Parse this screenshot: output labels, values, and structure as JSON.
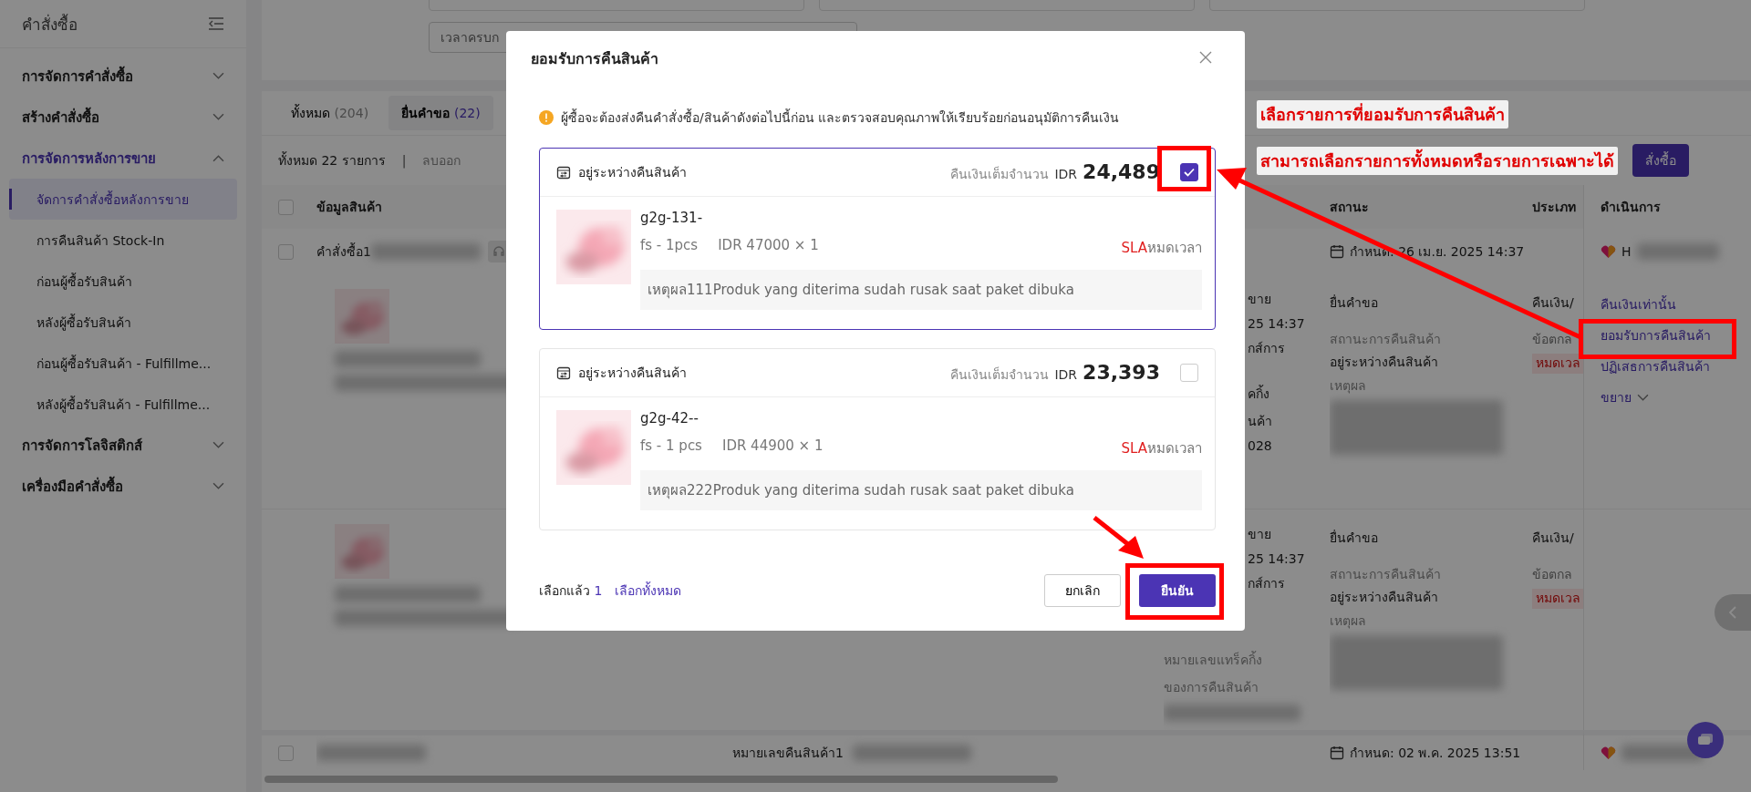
{
  "sidebar": {
    "title": "คำสั่งซื้อ",
    "groups": [
      {
        "label": "การจัดการคำสั่งซื้อ",
        "expanded": false
      },
      {
        "label": "สร้างคำสั่งซื้อ",
        "expanded": false
      },
      {
        "label": "การจัดการหลังการขาย",
        "expanded": true,
        "items": [
          {
            "label": "จัดการคำสั่งซื้อหลังการขาย",
            "selected": true
          },
          {
            "label": "การคืนสินค้า Stock-In",
            "selected": false
          },
          {
            "label": "ก่อนผู้ซื้อรับสินค้า",
            "selected": false
          },
          {
            "label": "หลังผู้ซื้อรับสินค้า",
            "selected": false
          },
          {
            "label": "ก่อนผู้ซื้อรับสินค้า - Fulfillme...",
            "selected": false
          },
          {
            "label": "หลังผู้ซื้อรับสินค้า - Fulfillme...",
            "selected": false
          }
        ]
      },
      {
        "label": "การจัดการโลจิสติกส์",
        "expanded": false
      },
      {
        "label": "เครื่องมือคำสั่งซื้อ",
        "expanded": false
      }
    ]
  },
  "filters": {
    "deadline_field": "เวลาครบก"
  },
  "tabs": [
    {
      "label": "ทั้งหมด",
      "count": "(204)",
      "selected": false
    },
    {
      "label": "ยื่นคำขอ",
      "count": "(22)",
      "selected": true
    }
  ],
  "toolbar": {
    "total": "ทั้งหมด 22 รายการ",
    "separator": "|",
    "remove": "ลบออก",
    "action_button": "สั่งซื้อ"
  },
  "table": {
    "columns": [
      "ข้อมูลสินค้า",
      "สถานะ",
      "ประเภท",
      "ดำเนินการ"
    ],
    "all_checked": false,
    "order_row": {
      "checked": false,
      "order": "คำสั่งซื้อ1",
      "deadline": "กำหนด: 26 เม.ย. 2025 14:37",
      "shop": "H"
    },
    "groups": [
      {
        "tail_blocks": [
          [
            "ขาย",
            "25 14:37",
            "กส์การ"
          ],
          [
            "คกิ้ง",
            "นค้า",
            "028"
          ]
        ],
        "status": {
          "title": "ยื่นคำขอ",
          "label": "สถานะการคืนสินค้า",
          "value": "อยู่ระหว่างคืนสินค้า",
          "reason": "เหตุผล"
        },
        "type": {
          "title": "คืนเงิน/",
          "subtitle": "ข้อตกล",
          "tag": "หมดเวล"
        },
        "actions": [
          {
            "label": "คืนเงินเท่านั้น"
          },
          {
            "label": "ยอมรับการคืนสินค้า"
          },
          {
            "label": "ปฏิเสธการคืนสินค้า"
          },
          {
            "label": "ขยาย",
            "kind": "expand"
          }
        ]
      },
      {
        "tail_blocks": [
          [
            "ขาย",
            "25 14:37",
            "กส์การ"
          ]
        ],
        "middle": [
          "หมายเลขแทร็คกิ้ง",
          "ของการคืนสินค้า"
        ],
        "status": {
          "title": "ยื่นคำขอ",
          "label": "สถานะการคืนสินค้า",
          "value": "อยู่ระหว่างคืนสินค้า",
          "reason": "เหตุผล"
        },
        "type": {
          "title": "คืนเงิน/",
          "subtitle": "ข้อตกล",
          "tag": "หมดเวล"
        }
      }
    ],
    "bottom_row": {
      "checked": false,
      "return_no": "หมายเลขคืนสินค้า1",
      "deadline": "กำหนด:  02 พ.ค. 2025 13:51"
    }
  },
  "modal": {
    "title": "ยอมรับการคืนสินค้า",
    "notice": "ผู้ซื้อจะต้องส่งคืนคำสั่งซื้อ/สินค้าดังต่อไปนี้ก่อน และตรวจสอบคุณภาพให้เรียบร้อยก่อนอนุมัติการคืนเงิน",
    "items": [
      {
        "status": "อยู่ระหว่างคืนสินค้า",
        "refund_label": "คืนเงินเต็มจำนวน",
        "currency": "IDR",
        "amount": "24,489",
        "selected": true,
        "name": "g2g-131-",
        "variant": "fs - 1pcs",
        "price": "IDR 47000 × 1",
        "sla": "SLA",
        "sla_state": "หมดเวลา",
        "reason": "เหตุผล111Produk yang diterima sudah rusak saat paket dibuka"
      },
      {
        "status": "อยู่ระหว่างคืนสินค้า",
        "refund_label": "คืนเงินเต็มจำนวน",
        "currency": "IDR",
        "amount": "23,393",
        "selected": false,
        "name": "g2g-42--",
        "variant": "fs - 1 pcs",
        "price": "IDR 44900 × 1",
        "sla": "SLA",
        "sla_state": "หมดเวลา",
        "reason": "เหตุผล222Produk yang diterima sudah rusak saat paket dibuka"
      }
    ],
    "selected_label": "เลือกแล้ว",
    "selected_count": "1",
    "select_all": "เลือกทั้งหมด",
    "cancel": "ยกเลิก",
    "confirm": "ยืนยัน"
  },
  "annotations": {
    "lines": [
      "เลือกรายการที่ยอมรับการคืนสินค้า",
      "สามารถเลือกรายการทั้งหมดหรือรายการเฉพาะได้"
    ]
  }
}
